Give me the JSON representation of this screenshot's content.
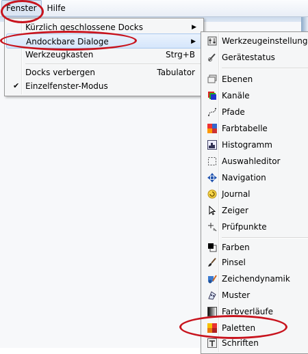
{
  "menubar": {
    "fenster_label": "Fenster",
    "hilfe_label": "Hilfe"
  },
  "fenster_menu": {
    "items": [
      {
        "label": "Kürzlich geschlossene Docks",
        "shortcut": "",
        "submenu": true
      },
      {
        "label": "Andockbare Dialoge",
        "shortcut": "",
        "submenu": true
      },
      {
        "label": "Werkzeugkasten",
        "shortcut": "Strg+B",
        "submenu": false
      },
      {
        "label": "Docks verbergen",
        "shortcut": "Tabulator",
        "submenu": false
      },
      {
        "label": "Einzelfenster-Modus",
        "shortcut": "",
        "submenu": false,
        "checked": true
      }
    ],
    "check_glyph": "✔",
    "arrow_glyph": "▶"
  },
  "dialogs_menu": {
    "items": [
      {
        "label": "Werkzeugeinstellungen",
        "icon": "tool-options-icon"
      },
      {
        "label": "Gerätestatus",
        "icon": "device-status-icon"
      },
      {
        "label": "Ebenen",
        "icon": "layers-icon"
      },
      {
        "label": "Kanäle",
        "icon": "channels-icon"
      },
      {
        "label": "Pfade",
        "icon": "paths-icon"
      },
      {
        "label": "Farbtabelle",
        "icon": "colormap-icon"
      },
      {
        "label": "Histogramm",
        "icon": "histogram-icon"
      },
      {
        "label": "Auswahleditor",
        "icon": "selection-editor-icon"
      },
      {
        "label": "Navigation",
        "icon": "navigation-icon"
      },
      {
        "label": "Journal",
        "icon": "undo-history-icon"
      },
      {
        "label": "Zeiger",
        "icon": "pointer-icon"
      },
      {
        "label": "Prüfpunkte",
        "icon": "sample-points-icon"
      },
      {
        "label": "Farben",
        "icon": "colors-icon"
      },
      {
        "label": "Pinsel",
        "icon": "brushes-icon"
      },
      {
        "label": "Zeichendynamik",
        "icon": "paint-dynamics-icon"
      },
      {
        "label": "Muster",
        "icon": "patterns-icon"
      },
      {
        "label": "Farbverläufe",
        "icon": "gradients-icon"
      },
      {
        "label": "Paletten",
        "icon": "palettes-icon"
      },
      {
        "label": "Schriften",
        "icon": "fonts-icon"
      }
    ]
  }
}
